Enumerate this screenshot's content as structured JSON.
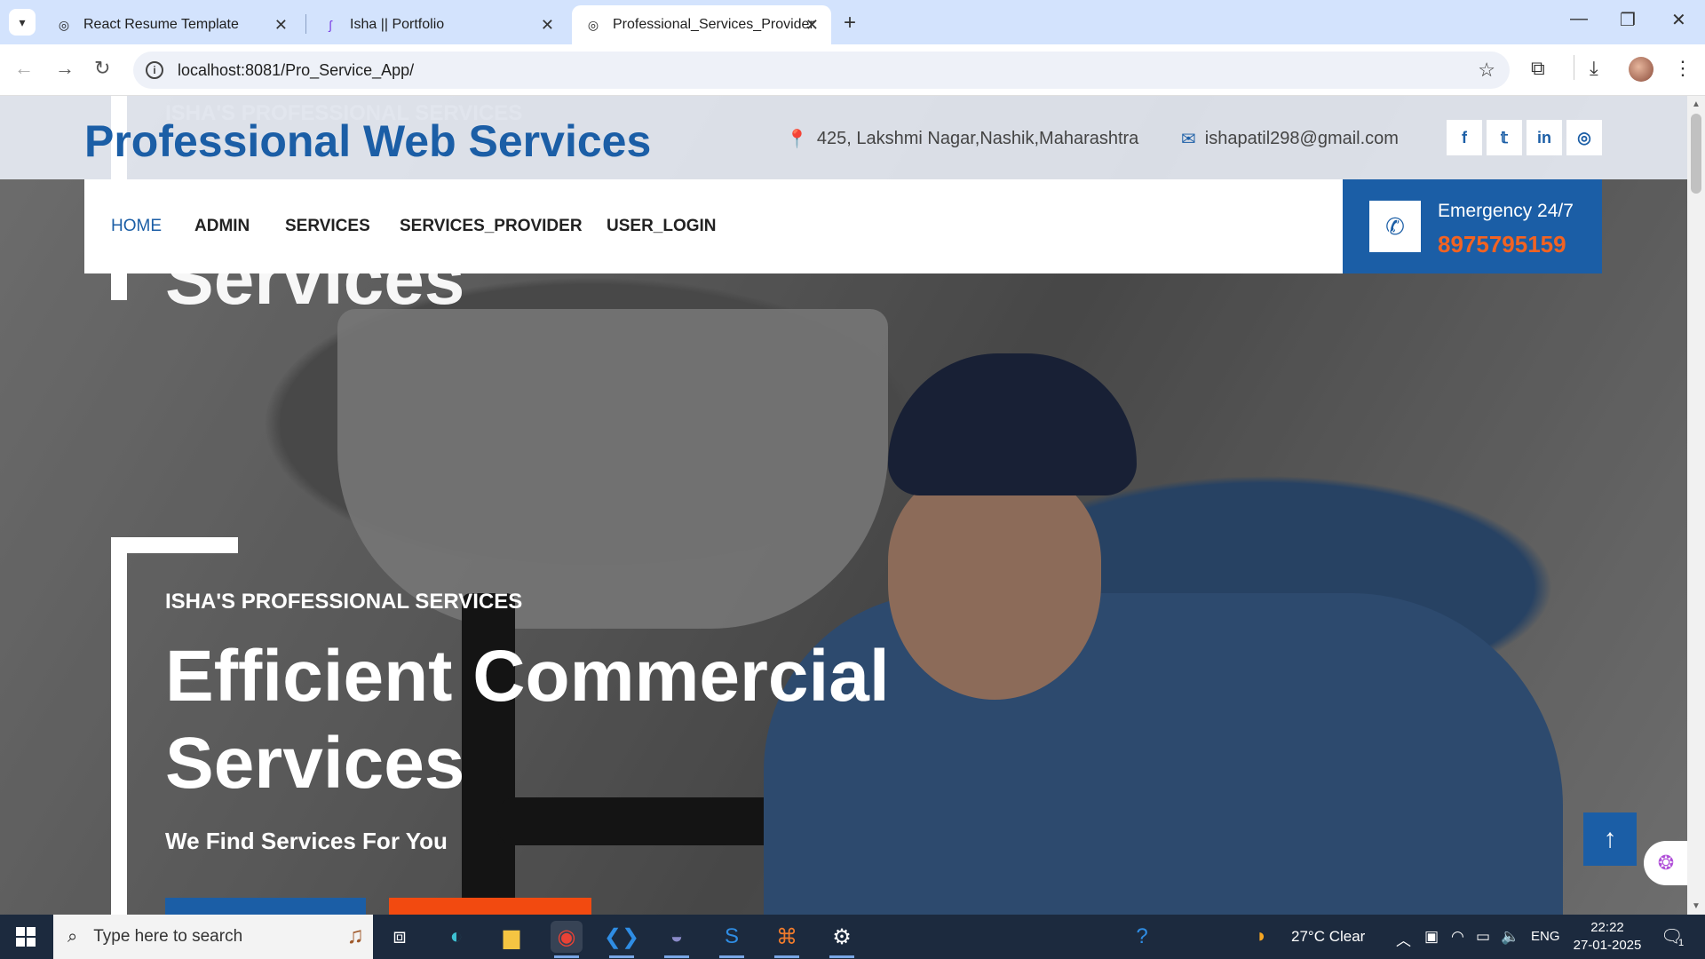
{
  "browser": {
    "tabs": [
      {
        "label": "React Resume Template",
        "active": false
      },
      {
        "label": "Isha || Portfolio",
        "active": false
      },
      {
        "label": "Professional_Services_Provider",
        "active": true
      }
    ],
    "url": "localhost:8081/Pro_Service_App/"
  },
  "site": {
    "brand": "Professional Web Services",
    "address": "425, Lakshmi Nagar,Nashik,Maharashtra",
    "email": "ishapatil298@gmail.com",
    "social": [
      "f",
      "t",
      "in",
      "ig"
    ],
    "nav": [
      "HOME",
      "ADMIN",
      "SERVICES",
      "SERVICES_PROVIDER",
      "USER_LOGIN"
    ],
    "emergency": {
      "label": "Emergency 24/7",
      "phone": "8975795159"
    },
    "hero": {
      "kicker": "ISHA'S PROFESSIONAL SERVICES",
      "headline_1": "Efficient Commercial",
      "headline_2": "Services",
      "tagline": "We Find Services For You"
    },
    "accent": "#1b5ea6",
    "highlight": "#f26322"
  },
  "taskbar": {
    "search_placeholder": "Type here to search",
    "weather": "27°C  Clear",
    "lang": "ENG",
    "time": "22:22",
    "date": "27-01-2025",
    "notif_count": "1"
  }
}
